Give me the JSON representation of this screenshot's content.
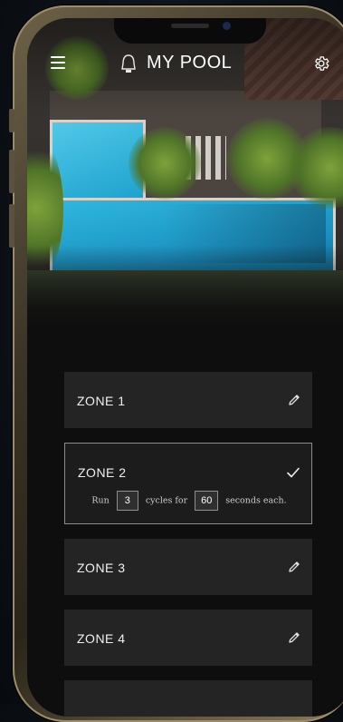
{
  "app": {
    "title": "MY POOL"
  },
  "icons": {
    "menu": "hamburger-menu-icon",
    "logo": "bell-logo-icon",
    "settings": "gear-icon",
    "edit": "pencil-icon",
    "confirm": "check-icon"
  },
  "colors": {
    "zone_bg": "#242424",
    "active_border": "#8b8b8b",
    "text": "#f0f0f0"
  },
  "zones": [
    {
      "label": "ZONE 1",
      "state": "collapsed"
    },
    {
      "label": "ZONE 2",
      "state": "expanded",
      "run_label": "Run",
      "cycles": "3",
      "cycles_label": "cycles for",
      "seconds": "60",
      "seconds_label": "seconds each."
    },
    {
      "label": "ZONE 3",
      "state": "collapsed"
    },
    {
      "label": "ZONE 4",
      "state": "collapsed"
    }
  ]
}
